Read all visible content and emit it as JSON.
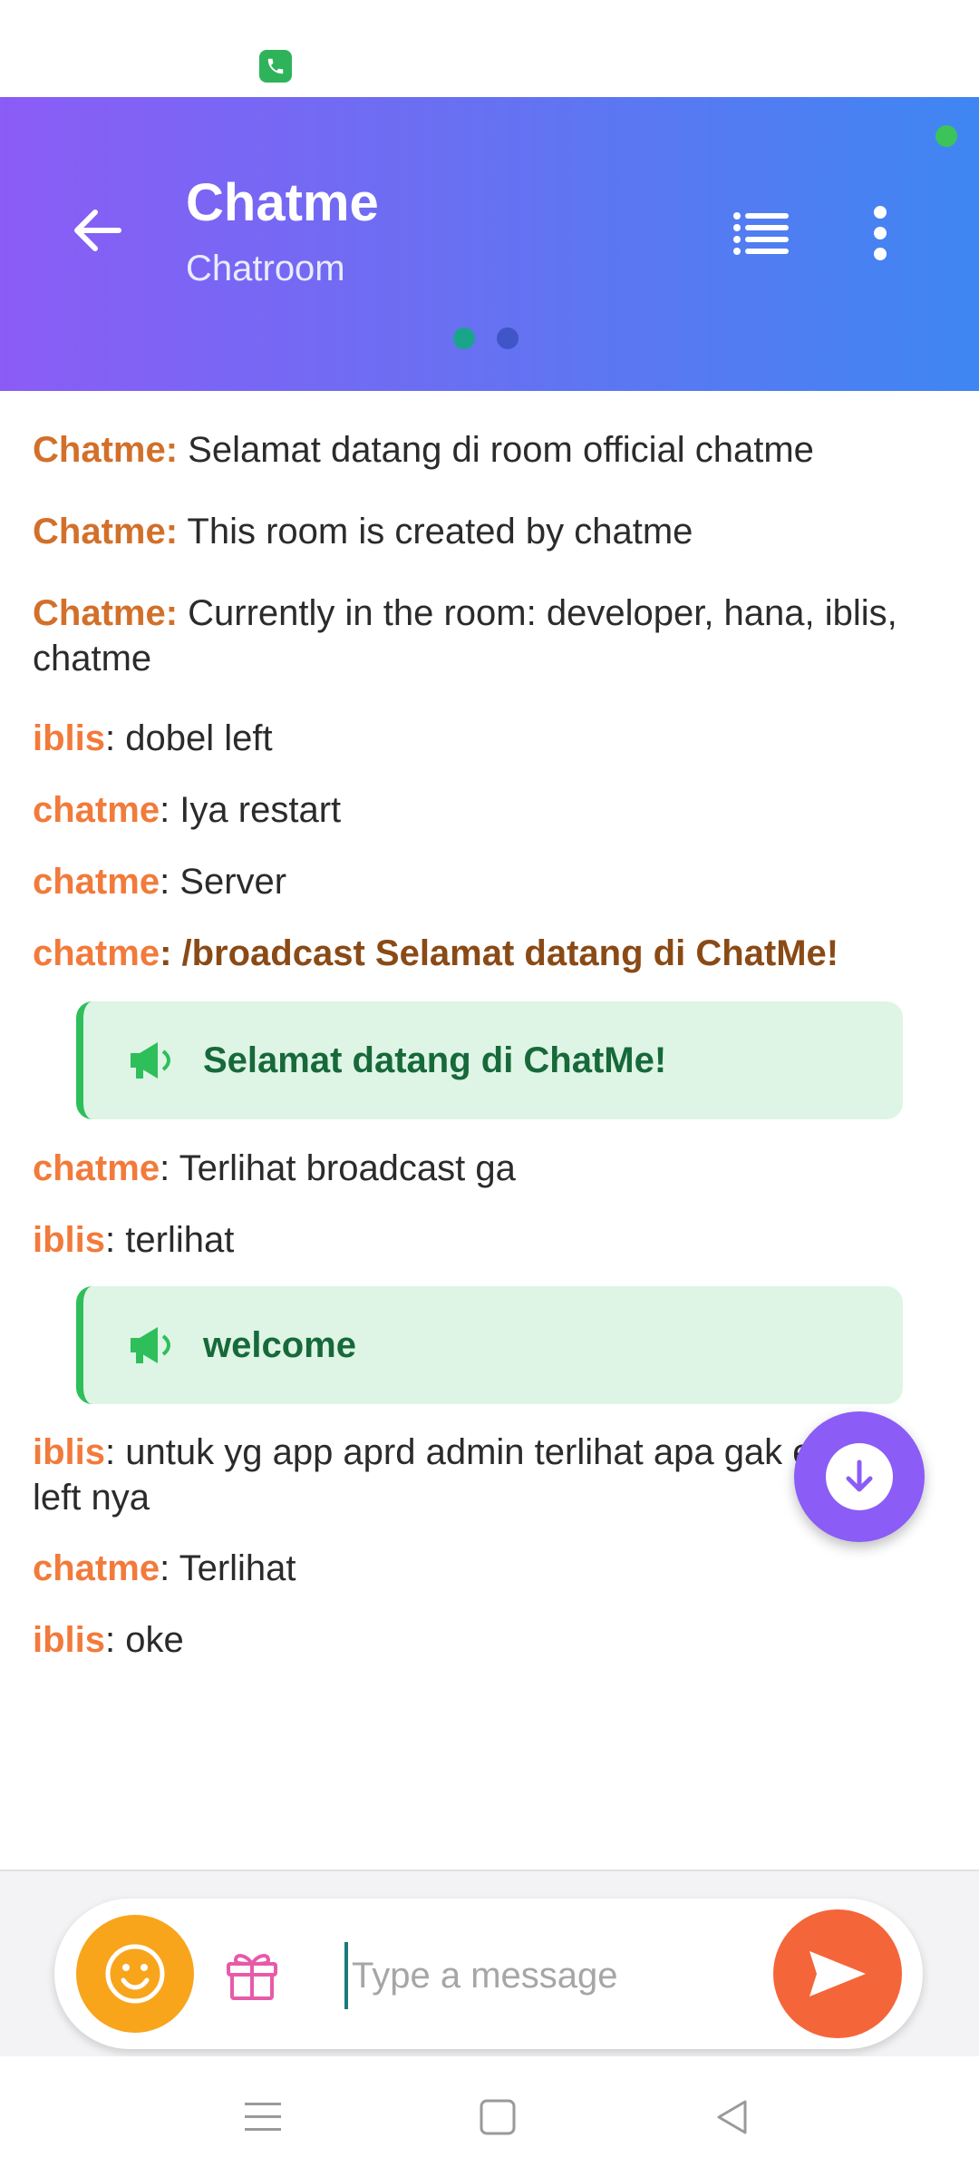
{
  "header": {
    "title": "Chatme",
    "subtitle": "Chatroom",
    "gradient_start": "#8b5cf6",
    "gradient_end": "#3f86f2",
    "page_indicator": {
      "count": 2,
      "active_index": 0,
      "active_color": "#1aa58a",
      "inactive_color": "#3f55c8"
    }
  },
  "messages": [
    {
      "sender": "Chatme:",
      "text": " Selamat datang di room official chatme"
    },
    {
      "sender": "Chatme:",
      "text": " This room is created by chatme"
    },
    {
      "sender": "Chatme:",
      "text": " Currently in the room: developer, hana, iblis, chatme"
    },
    {
      "sender": "iblis",
      "text": ": dobel left"
    },
    {
      "sender": "chatme",
      "text": ": Iya restart"
    },
    {
      "sender": "chatme",
      "text": ": Server"
    },
    {
      "sender": "chatme",
      "text": ": /broadcast Selamat datang di ChatMe!"
    },
    {
      "broadcast": "Selamat datang di ChatMe!"
    },
    {
      "sender": "chatme",
      "text": ": Terlihat broadcast ga"
    },
    {
      "sender": "iblis",
      "text": ": terlihat"
    },
    {
      "broadcast": "welcome"
    },
    {
      "sender": "iblis",
      "text": ": untuk yg app aprd admin terlihat apa gak enter left nya"
    },
    {
      "sender": "chatme",
      "text": ": Terlihat"
    },
    {
      "sender": "iblis",
      "text": ": oke"
    }
  ],
  "composer": {
    "placeholder": "Type a message",
    "emoji_color": "#f8a51c",
    "gift_color": "#e85aa8",
    "send_color": "#f5653a"
  },
  "colors": {
    "system_sender": "#d2702a",
    "user_sender": "#f27a3a",
    "broadcast_bg": "#def5e6",
    "broadcast_text": "#17693a",
    "fab": "#8b5cf6"
  },
  "icons": [
    "phone-icon",
    "back-arrow-icon",
    "user-list-icon",
    "more-vertical-icon",
    "megaphone-icon",
    "arrow-down-icon",
    "emoji-icon",
    "gift-icon",
    "send-icon",
    "menu-icon",
    "home-square-icon",
    "back-triangle-icon"
  ]
}
